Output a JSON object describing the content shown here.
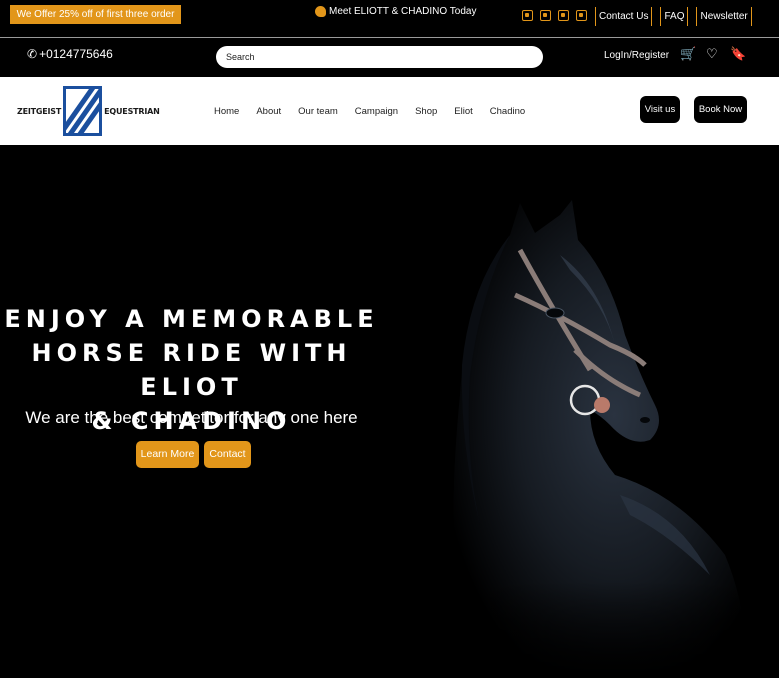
{
  "topbar": {
    "offer": "We Offer 25% off of first three order",
    "announcement": "Meet ELIOTT & CHADINO Today",
    "social_icons": [
      "facebook-icon",
      "twitter-icon",
      "instagram-icon",
      "linkedin-icon"
    ],
    "links": [
      "Contact Us",
      "FAQ",
      "Newsletter"
    ]
  },
  "utility": {
    "phone": "+0124775646",
    "search_placeholder": "Search",
    "login": "LogIn/Register"
  },
  "nav": {
    "logo_left": "ZEITGEIST",
    "logo_right": "EQUESTRIAN",
    "items": [
      "Home",
      "About",
      "Our team",
      "Campaign",
      "Shop",
      "Eliot",
      "Chadino"
    ],
    "visit": "Visit us",
    "book": "Book Now"
  },
  "hero": {
    "headline_line1": "ENJOY A MEMORABLE",
    "headline_line2": "HORSE RIDE WITH ELIOT",
    "headline_line3": "& CHADINO",
    "subheading": "We are the best competitor for any one here",
    "learn_more": "Learn More",
    "contact": "Contact"
  },
  "colors": {
    "accent": "#e2961a",
    "brand_blue": "#1b4f9e",
    "background": "#000000"
  }
}
